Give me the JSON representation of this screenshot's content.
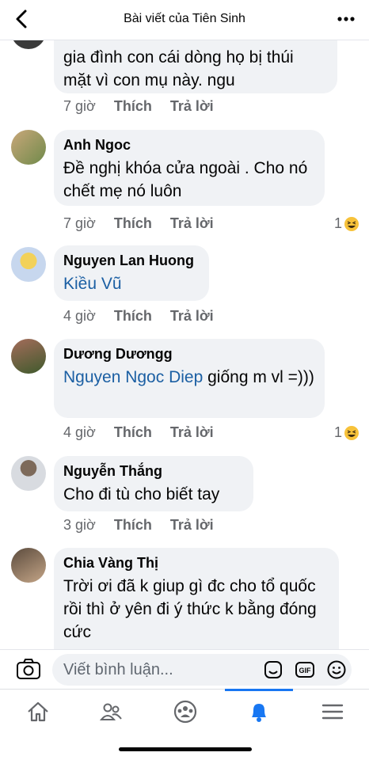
{
  "header": {
    "title": "Bài viết của Tiên Sinh"
  },
  "comments": [
    {
      "author": "",
      "text": "gia đình con cái dòng họ bị thúi mặt vì con mụ này. ngu",
      "mention": "",
      "time": "7 giờ",
      "like": "Thích",
      "reply": "Trả lời",
      "reactions": ""
    },
    {
      "author": "Anh Ngoc",
      "text": "Đề nghị khóa cửa ngoài . Cho nó chết mẹ nó luôn",
      "mention": "",
      "time": "7 giờ",
      "like": "Thích",
      "reply": "Trả lời",
      "reactions": "1"
    },
    {
      "author": "Nguyen Lan Huong",
      "text": "",
      "mention": "Kiều Vũ",
      "time": "4 giờ",
      "like": "Thích",
      "reply": "Trả lời",
      "reactions": ""
    },
    {
      "author": "Dương Dươngg",
      "text": "giống m vl =)))",
      "mention": "Nguyen Ngoc Diep",
      "time": "4 giờ",
      "like": "Thích",
      "reply": "Trả lời",
      "reactions": "1"
    },
    {
      "author": "Nguyễn Thắng",
      "text": "Cho đi tù cho biết tay",
      "mention": "",
      "time": "3 giờ",
      "like": "Thích",
      "reply": "Trả lời",
      "reactions": ""
    },
    {
      "author": "Chia Vàng Thị",
      "text": "Trời ơi đã k giup gì đc cho tổ quốc rồi thì ở yên đi ý thức k bằng đóng cức",
      "mention": "",
      "time": "",
      "like": "",
      "reply": "",
      "reactions": ""
    }
  ],
  "composer": {
    "placeholder": "Viết bình luận..."
  },
  "icons": [
    "back-icon",
    "more-icon",
    "camera-icon",
    "sticker-icon",
    "gif-icon",
    "emoji-icon",
    "home-icon",
    "friends-icon",
    "groups-icon",
    "notifications-icon",
    "menu-icon",
    "haha-reaction-icon"
  ],
  "colors": {
    "accent": "#1877f2",
    "mention": "#1b5fa3",
    "bubble": "#f0f2f5",
    "meta": "#65676b"
  }
}
